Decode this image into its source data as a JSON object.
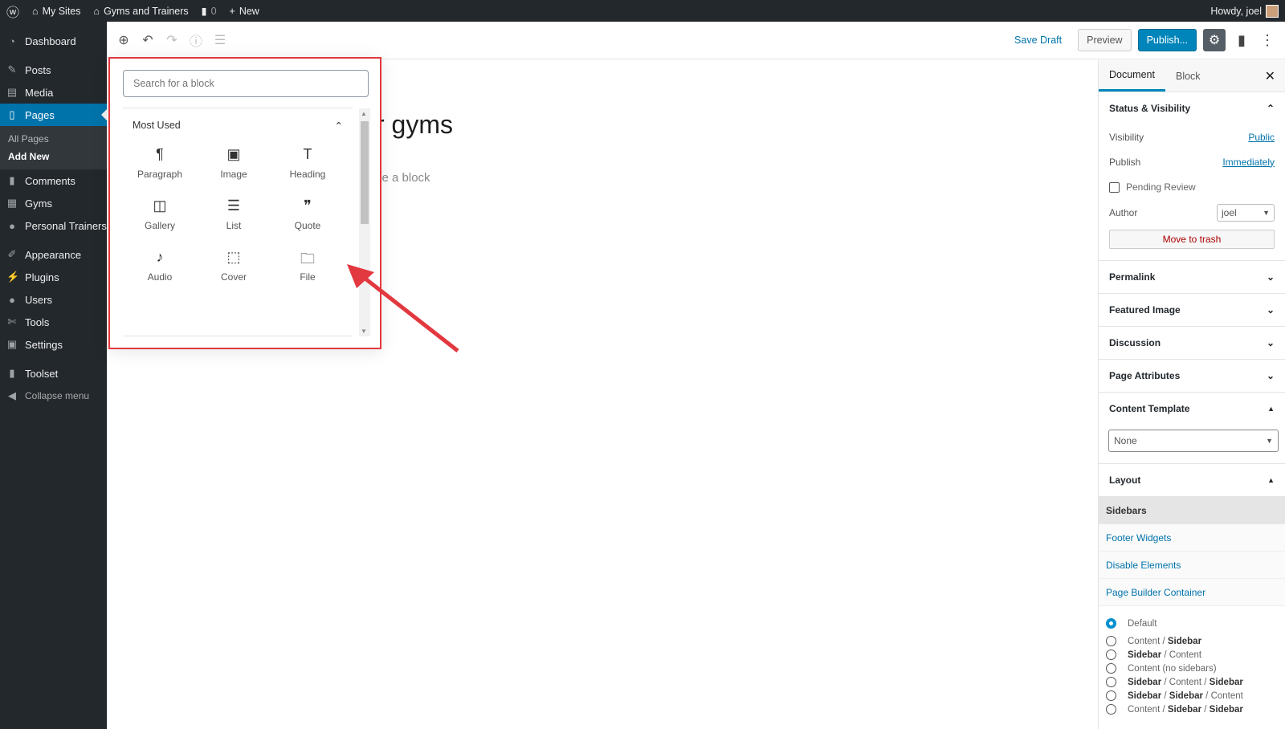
{
  "adminbar": {
    "my_sites": "My Sites",
    "site": "Gyms and Trainers",
    "comments": "0",
    "new": "New",
    "howdy": "Howdy, joel"
  },
  "sidebar": {
    "items": [
      {
        "label": "Dashboard",
        "icon": "dashboard-icon"
      },
      {
        "label": "Posts",
        "icon": "pin-icon"
      },
      {
        "label": "Media",
        "icon": "media-icon"
      },
      {
        "label": "Pages",
        "icon": "pages-icon"
      },
      {
        "label": "Comments",
        "icon": "comment-icon"
      },
      {
        "label": "Gyms",
        "icon": "gyms-icon"
      },
      {
        "label": "Personal Trainers",
        "icon": "user-icon"
      },
      {
        "label": "Appearance",
        "icon": "brush-icon"
      },
      {
        "label": "Plugins",
        "icon": "plugin-icon"
      },
      {
        "label": "Users",
        "icon": "user-icon"
      },
      {
        "label": "Tools",
        "icon": "wrench-icon"
      },
      {
        "label": "Settings",
        "icon": "settings-icon"
      },
      {
        "label": "Toolset",
        "icon": "toolset-icon"
      },
      {
        "label": "Collapse menu",
        "icon": "collapse-icon"
      }
    ],
    "submenu": [
      "All Pages",
      "Add New"
    ]
  },
  "toolbar": {
    "save_draft": "Save Draft",
    "preview": "Preview",
    "publish": "Publish..."
  },
  "editor": {
    "title_fragment": "r gyms",
    "hint_fragment": "se a block"
  },
  "inserter": {
    "placeholder": "Search for a block",
    "category": "Most Used",
    "blocks": [
      {
        "label": "Paragraph",
        "glyph": "¶"
      },
      {
        "label": "Image",
        "glyph": "▣"
      },
      {
        "label": "Heading",
        "glyph": "T"
      },
      {
        "label": "Gallery",
        "glyph": "◫"
      },
      {
        "label": "List",
        "glyph": "☰"
      },
      {
        "label": "Quote",
        "glyph": "❞"
      },
      {
        "label": "Audio",
        "glyph": "♪"
      },
      {
        "label": "Cover",
        "glyph": "⬚"
      },
      {
        "label": "File",
        "glyph": "🗀"
      }
    ]
  },
  "settings": {
    "tabs": [
      "Document",
      "Block"
    ],
    "status_title": "Status & Visibility",
    "visibility_label": "Visibility",
    "visibility_value": "Public",
    "publish_label": "Publish",
    "publish_value": "Immediately",
    "pending": "Pending Review",
    "author_label": "Author",
    "author_value": "joel",
    "trash": "Move to trash",
    "sections": [
      "Permalink",
      "Featured Image",
      "Discussion",
      "Page Attributes"
    ],
    "content_template": "Content Template",
    "template_value": "None",
    "layout": "Layout",
    "sidebars": "Sidebars",
    "links": [
      "Footer Widgets",
      "Disable Elements",
      "Page Builder Container"
    ],
    "radios": [
      {
        "parts": [
          [
            "Default",
            false
          ]
        ],
        "checked": true
      },
      {
        "parts": [
          [
            "Content",
            false
          ],
          [
            " / ",
            false
          ],
          [
            "Sidebar",
            true
          ]
        ]
      },
      {
        "parts": [
          [
            "Sidebar",
            true
          ],
          [
            " / ",
            false
          ],
          [
            "Content",
            false
          ]
        ]
      },
      {
        "parts": [
          [
            "Content (no sidebars)",
            false
          ]
        ]
      },
      {
        "parts": [
          [
            "Sidebar",
            true
          ],
          [
            " / ",
            false
          ],
          [
            "Content",
            false
          ],
          [
            " / ",
            false
          ],
          [
            "Sidebar",
            true
          ]
        ]
      },
      {
        "parts": [
          [
            "Sidebar",
            true
          ],
          [
            " / ",
            false
          ],
          [
            "Sidebar",
            true
          ],
          [
            " / ",
            false
          ],
          [
            "Content",
            false
          ]
        ]
      },
      {
        "parts": [
          [
            "Content",
            false
          ],
          [
            " / ",
            false
          ],
          [
            "Sidebar",
            true
          ],
          [
            " / ",
            false
          ],
          [
            "Sidebar",
            true
          ]
        ]
      }
    ]
  },
  "colors": {
    "accent": "#0085ba",
    "highlight": "#e2383f",
    "adminbar": "#23282d"
  }
}
